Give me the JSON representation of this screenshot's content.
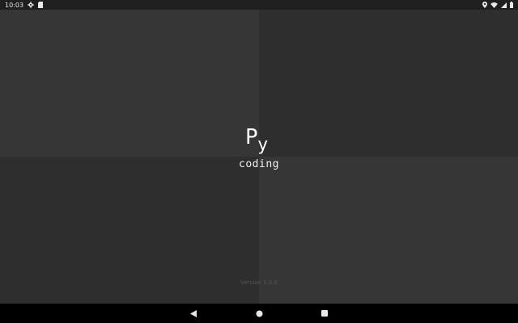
{
  "status_bar": {
    "time": "10:03",
    "left_icons": [
      "settings-icon",
      "sd-card-icon"
    ],
    "right_icons": [
      "location-icon",
      "wifi-icon",
      "signal-icon",
      "battery-icon"
    ]
  },
  "splash": {
    "logo_p": "P",
    "logo_y": "y",
    "subtitle": "coding",
    "version": "Version 1.0.0"
  },
  "nav_bar": {
    "buttons": [
      "back-icon",
      "home-icon",
      "recents-icon"
    ]
  },
  "colors": {
    "status_bg": "#1f1f1f",
    "quad_light": "#363636",
    "quad_dark": "#2e2e2e",
    "nav_bg": "#000000",
    "text": "#ffffff",
    "version_text": "#555555"
  }
}
